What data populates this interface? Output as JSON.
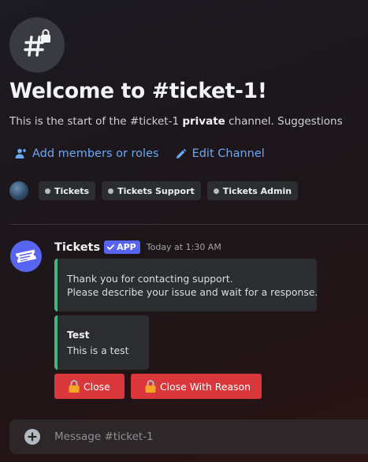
{
  "channel": {
    "icon": "hashtag-lock-icon",
    "welcome_title": "Welcome to #ticket-1!",
    "subtitle_prefix": "This is the start of the #ticket-1 ",
    "subtitle_bold": "private",
    "subtitle_suffix": " channel. Suggestions"
  },
  "actions": {
    "add_members": {
      "label": "Add members or roles",
      "icon": "add-person-icon"
    },
    "edit_channel": {
      "label": "Edit Channel",
      "icon": "pencil-icon"
    }
  },
  "roles": [
    {
      "label": "Tickets"
    },
    {
      "label": "Tickets Support"
    },
    {
      "label": "Tickets Admin"
    }
  ],
  "message": {
    "username": "Tickets",
    "badge": "APP",
    "timestamp": "Today at 1:30 AM",
    "embeds": [
      {
        "lines": [
          "Thank you for contacting support.",
          "Please describe your issue and wait for a response."
        ]
      },
      {
        "title": "Test",
        "description": "This is a test"
      }
    ],
    "buttons": [
      {
        "label": "Close"
      },
      {
        "label": "Close With Reason"
      }
    ]
  },
  "composer": {
    "placeholder": "Message #ticket-1"
  },
  "colors": {
    "link": "#69a8f4",
    "embed_accent": "#43b581",
    "danger": "#da373c",
    "blurple": "#5865f2"
  }
}
